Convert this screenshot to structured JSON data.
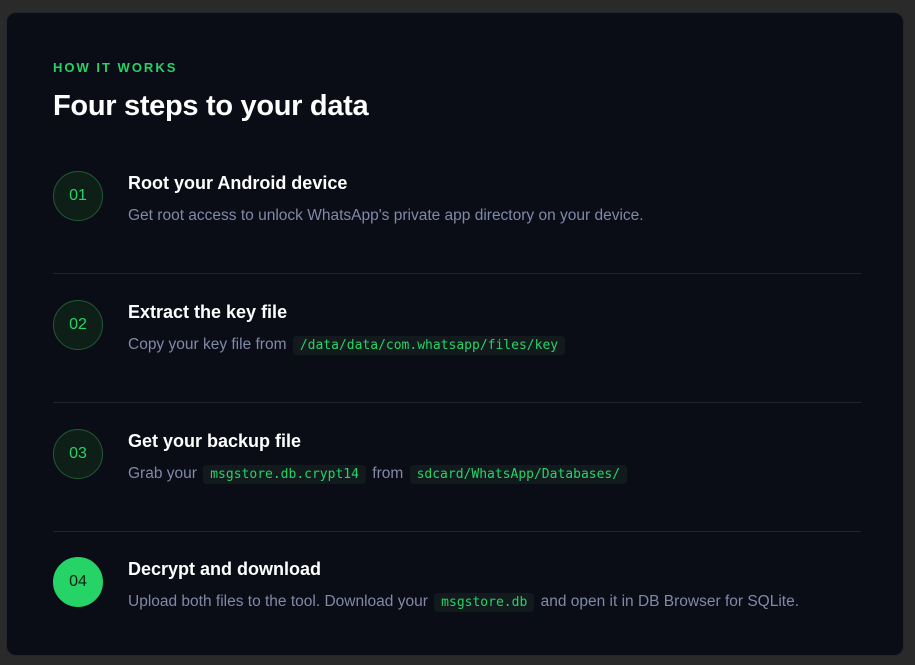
{
  "section": {
    "eyebrow": "HOW IT WORKS",
    "title": "Four steps to your data"
  },
  "steps": [
    {
      "number": "01",
      "title": "Root your Android device",
      "description": "Get root access to unlock WhatsApp's private app directory on your device."
    },
    {
      "number": "02",
      "title": "Extract the key file",
      "desc_prefix": "Copy your key file from",
      "code1": "/data/data/com.whatsapp/files/key"
    },
    {
      "number": "03",
      "title": "Get your backup file",
      "desc_prefix": "Grab your",
      "code1": "msgstore.db.crypt14",
      "desc_middle": "from",
      "code2": "sdcard/WhatsApp/Databases/"
    },
    {
      "number": "04",
      "title": "Decrypt and download",
      "desc_prefix": "Upload both files to the tool. Download your",
      "code1": "msgstore.db",
      "desc_suffix": "and open it in DB Browser for SQLite.",
      "active": true
    }
  ],
  "colors": {
    "accent": "#25d366",
    "background": "#0a0d16",
    "muted_text": "#8089a8"
  }
}
